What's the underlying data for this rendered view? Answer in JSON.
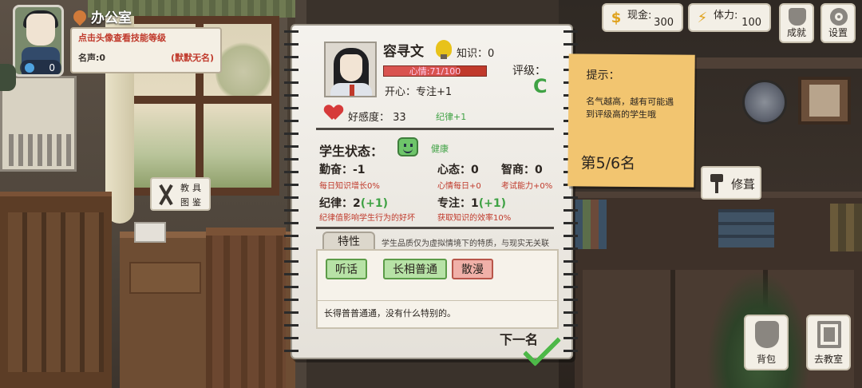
{
  "header": {
    "location": "办公室",
    "hint": "点击头像查看技能等级",
    "fame_label": "名声:0",
    "fame_title": "(默默无名)",
    "level": "0"
  },
  "resources": {
    "money_label": "现金:",
    "money_value": "300",
    "money_icon": "dollar-icon",
    "stamina_label": "体力:",
    "stamina_value": "100",
    "stamina_icon": "lightning-icon"
  },
  "top_buttons": {
    "achievement": "成就",
    "settings": "设置"
  },
  "student": {
    "name": "容寻文",
    "knowledge": "知识：0",
    "mood_text": "心情:71/100",
    "mood_fraction": 0.71,
    "happy_line": "开心：专注+1",
    "grade_label": "评级：",
    "grade": "C",
    "favor": "好感度： 33",
    "favor_bonus": "纪律+1",
    "status_title": "学生状态：",
    "health": "健康",
    "stats": {
      "diligence": "勤奋：-1",
      "diligence_sub": "每日知识增长0%",
      "mentality": "心态：0",
      "mentality_sub": "心情每日+0",
      "iq": "智商：0",
      "iq_sub": "考试能力+0%",
      "discipline": "纪律：2",
      "discipline_plus": "(+1)",
      "discipline_sub": "纪律值影响学生行为的好坏",
      "focus": "专注：1",
      "focus_plus": "(+1)",
      "focus_sub": "获取知识的效率10%"
    },
    "traits_tab": "特性",
    "traits_note": "学生品质仅为虚拟情境下的特质，与现实无关联",
    "traits": [
      "听话",
      "长相普通",
      "散漫"
    ],
    "trait_desc": "长得普普通通，没有什么特别的。",
    "next": "下一名"
  },
  "hint_note": {
    "title": "提示：",
    "body": "名气越高，越有可能遇到评级高的学生哦",
    "page": "第5/6名"
  },
  "floating": {
    "tools_l1": "教具",
    "tools_l2": "图鉴",
    "repair": "修葺",
    "bag": "背包",
    "classroom": "去教室"
  },
  "colors": {
    "accent_green": "#3fa244",
    "warning_red": "#c0392b",
    "note_yellow": "#f2c570"
  }
}
